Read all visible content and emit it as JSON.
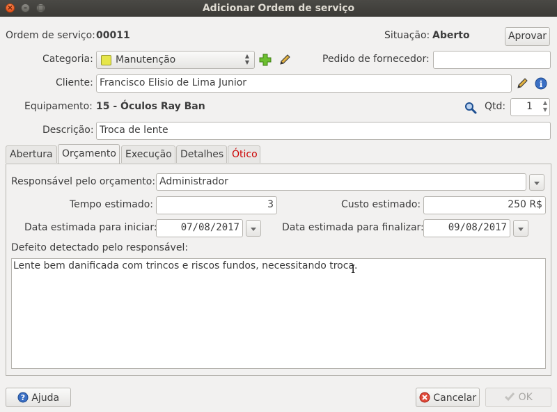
{
  "window": {
    "title": "Adicionar Ordem de serviço"
  },
  "header": {
    "os_label": "Ordem de serviço:",
    "os_value": "00011",
    "situacao_label": "Situação:",
    "situacao_value": "Aberto",
    "aprovar_label": "Aprovar"
  },
  "form": {
    "categoria_label": "Categoria:",
    "categoria_value": "Manutenção",
    "categoria_color": "#e6e64a",
    "pedido_label": "Pedido de fornecedor:",
    "pedido_value": "",
    "cliente_label": "Cliente:",
    "cliente_value": "Francisco Elisio de Lima Junior",
    "equipamento_label": "Equipamento:",
    "equipamento_value": "15 - Óculos Ray Ban",
    "qtd_label": "Qtd:",
    "qtd_value": "1",
    "descricao_label": "Descrição:",
    "descricao_value": "Troca de lente"
  },
  "tabs": [
    {
      "label": "Abertura"
    },
    {
      "label": "Orçamento"
    },
    {
      "label": "Execução"
    },
    {
      "label": "Detalhes"
    },
    {
      "label": "Ótico"
    }
  ],
  "orcamento": {
    "responsavel_label": "Responsável pelo orçamento:",
    "responsavel_value": "Administrador",
    "tempo_label": "Tempo estimado:",
    "tempo_value": "3",
    "custo_label": "Custo estimado:",
    "custo_value": "250 R$",
    "data_inicio_label": "Data estimada para iniciar:",
    "data_inicio_value": "07/08/2017",
    "data_fim_label": "Data estimada para finalizar:",
    "data_fim_value": "09/08/2017",
    "defeito_label": "Defeito detectado pelo responsável:",
    "defeito_value": "Lente bem danificada com trincos e riscos fundos, necessitando troca."
  },
  "footer": {
    "ajuda_label": "Ajuda",
    "cancelar_label": "Cancelar",
    "ok_label": "OK"
  },
  "colors": {
    "otico_tab": "#cc0000",
    "accent_green": "#5aa02c"
  }
}
